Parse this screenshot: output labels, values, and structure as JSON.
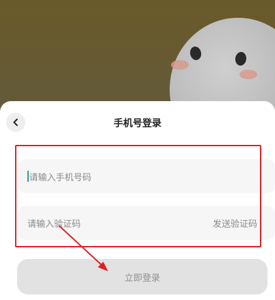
{
  "header": {
    "title": "手机号登录",
    "back_icon": "chevron-left-icon"
  },
  "form": {
    "phone_placeholder": "请输入手机号码",
    "code_placeholder": "请输入验证码",
    "send_code_label": "发送验证码"
  },
  "actions": {
    "login_label": "立即登录"
  },
  "colors": {
    "annotation_red": "#e02020",
    "button_disabled_bg": "#e2e2e2"
  }
}
